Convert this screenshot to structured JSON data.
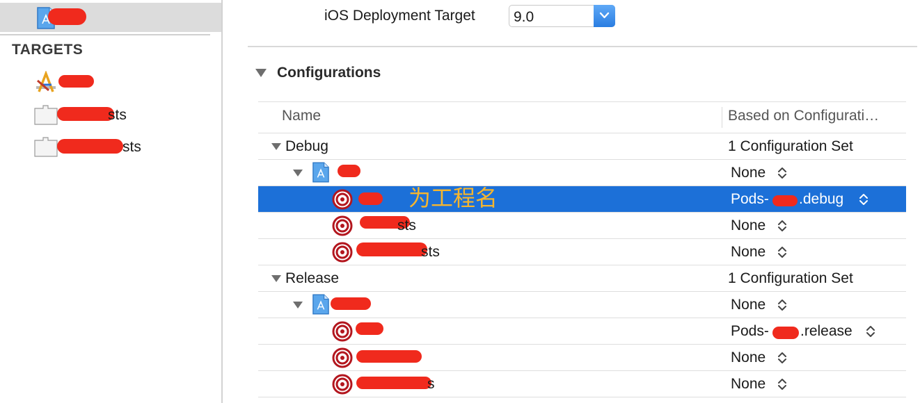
{
  "sidebar": {
    "project_name": "",
    "targets_heading": "TARGETS",
    "targets": [
      {
        "label_suffix": "",
        "icon": "app-target-icon"
      },
      {
        "label_suffix": "sts",
        "icon": "test-bundle-icon"
      },
      {
        "label_suffix": "sts",
        "icon": "test-bundle-icon"
      }
    ]
  },
  "deployment": {
    "label": "iOS Deployment Target",
    "value": "9.0"
  },
  "configurations": {
    "heading": "Configurations",
    "columns": [
      "Name",
      "Based on Configurati…"
    ],
    "groups": [
      {
        "name": "Debug",
        "summary": "1 Configuration Set",
        "project_value": "None",
        "targets": [
          {
            "value": "Pods-",
            "value_suffix": ".debug",
            "selected": true
          },
          {
            "value": "None",
            "value_suffix": "",
            "selected": false,
            "name_suffix": "sts"
          },
          {
            "value": "None",
            "value_suffix": "",
            "selected": false,
            "name_suffix": "sts"
          }
        ]
      },
      {
        "name": "Release",
        "summary": "1 Configuration Set",
        "project_value": "None",
        "targets": [
          {
            "value": "Pods-",
            "value_suffix": ".release",
            "selected": false
          },
          {
            "value": "None",
            "value_suffix": "",
            "selected": false,
            "name_suffix": ""
          },
          {
            "value": "None",
            "value_suffix": "",
            "selected": false,
            "name_suffix": "s"
          }
        ]
      }
    ]
  },
  "annotation": "为工程名",
  "colors": {
    "selection": "#1c70d8",
    "redaction": "#f02a1d",
    "annotation": "#f5b52e",
    "target_icon": "#b3161e"
  }
}
